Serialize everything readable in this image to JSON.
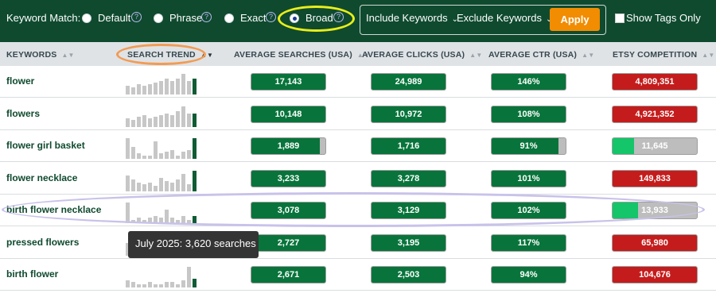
{
  "filters": {
    "keyword_match_label": "Keyword Match:",
    "options": [
      "Default",
      "Phrase",
      "Exact",
      "Broad"
    ],
    "selected": "Broad",
    "include_label": "Include Keywords",
    "exclude_label": "Exclude Keywords",
    "apply_label": "Apply",
    "show_tags_label": "Show Tags Only",
    "show_tags_checked": false
  },
  "columns": [
    "KEYWORDS",
    "SEARCH TREND",
    "AVERAGE SEARCHES (USA)",
    "AVERAGE CLICKS (USA)",
    "AVERAGE CTR (USA)",
    "ETSY COMPETITION"
  ],
  "rows": [
    {
      "keyword": "flower",
      "searches": "17,143",
      "clicks": "24,989",
      "ctr": "146%",
      "competition": "4,809,351",
      "trend": [
        5,
        4,
        6,
        5,
        6,
        7,
        8,
        9,
        8,
        9,
        12,
        8,
        9
      ]
    },
    {
      "keyword": "flowers",
      "searches": "10,148",
      "clicks": "10,972",
      "ctr": "108%",
      "competition": "4,921,352",
      "trend": [
        5,
        4,
        6,
        7,
        5,
        6,
        7,
        8,
        7,
        9,
        12,
        8,
        8
      ]
    },
    {
      "keyword": "flower girl basket",
      "searches": "1,889",
      "clicks": "1,716",
      "ctr": "91%",
      "competition": "11,645",
      "trend": [
        12,
        7,
        3,
        2,
        2,
        10,
        3,
        4,
        5,
        2,
        4,
        5,
        12
      ]
    },
    {
      "keyword": "flower necklace",
      "searches": "3,233",
      "clicks": "3,278",
      "ctr": "101%",
      "competition": "149,833",
      "trend": [
        9,
        7,
        5,
        4,
        5,
        3,
        8,
        6,
        5,
        7,
        10,
        4,
        12
      ]
    },
    {
      "keyword": "birth flower necklace",
      "searches": "3,078",
      "clicks": "3,129",
      "ctr": "102%",
      "competition": "13,933",
      "trend": [
        12,
        2,
        3,
        2,
        3,
        4,
        3,
        8,
        3,
        2,
        4,
        2,
        4
      ]
    },
    {
      "keyword": "pressed flowers",
      "searches": "2,727",
      "clicks": "3,195",
      "ctr": "117%",
      "competition": "65,980",
      "trend": [
        6,
        5,
        4,
        7,
        5,
        6,
        8,
        7,
        6,
        5,
        7,
        9,
        10
      ]
    },
    {
      "keyword": "birth flower",
      "searches": "2,671",
      "clicks": "2,503",
      "ctr": "94%",
      "competition": "104,676",
      "trend": [
        4,
        3,
        2,
        2,
        3,
        2,
        2,
        3,
        3,
        2,
        4,
        12,
        5
      ]
    }
  ],
  "metric_fill": {
    "searches": [
      1,
      1,
      0.92,
      1,
      1,
      1,
      1
    ],
    "clicks": [
      1,
      1,
      1,
      1,
      1,
      1,
      1
    ],
    "ctr": [
      1,
      1,
      0.9,
      1,
      1,
      1,
      1
    ],
    "competition": [
      1,
      1,
      0.25,
      1,
      0.3,
      1,
      1
    ]
  },
  "competition_color": [
    "red",
    "red",
    "light",
    "red",
    "light",
    "red",
    "red"
  ],
  "tooltip": "July 2025: 3,620 searches",
  "colors": {
    "header_bg": "#0f4a2f",
    "metric_green": "#08743b",
    "metric_red": "#c41c1c",
    "metric_light_green": "#14c56a",
    "apply_orange": "#f28c00"
  }
}
